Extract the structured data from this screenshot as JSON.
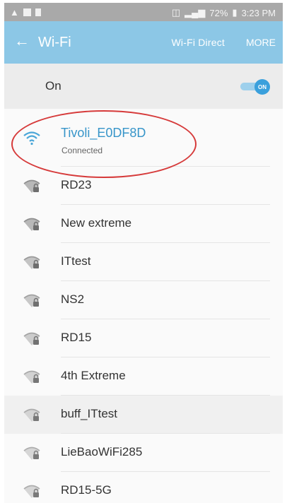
{
  "status_bar": {
    "battery": "72%",
    "time": "3:23 PM"
  },
  "app_bar": {
    "back_icon": "arrow-left-icon",
    "title": "Wi-Fi",
    "wifi_direct": "Wi-Fi Direct",
    "more": "MORE"
  },
  "toggle": {
    "label": "On",
    "switch_text": "ON",
    "state": "on"
  },
  "networks": [
    {
      "name": "Tivoli_E0DF8D",
      "status": "Connected",
      "connected": true,
      "locked": false
    },
    {
      "name": "RD23",
      "locked": true
    },
    {
      "name": "New extreme",
      "locked": true
    },
    {
      "name": "ITtest",
      "locked": true
    },
    {
      "name": "NS2",
      "locked": true
    },
    {
      "name": "RD15",
      "locked": true
    },
    {
      "name": "4th Extreme",
      "locked": true
    },
    {
      "name": "buff_ITtest",
      "locked": true
    },
    {
      "name": "LieBaoWiFi285",
      "locked": true
    },
    {
      "name": "RD15-5G",
      "locked": true
    }
  ],
  "colors": {
    "app_bar": "#8cc7e6",
    "accent": "#3795c9",
    "annotation": "#d63a3a"
  }
}
